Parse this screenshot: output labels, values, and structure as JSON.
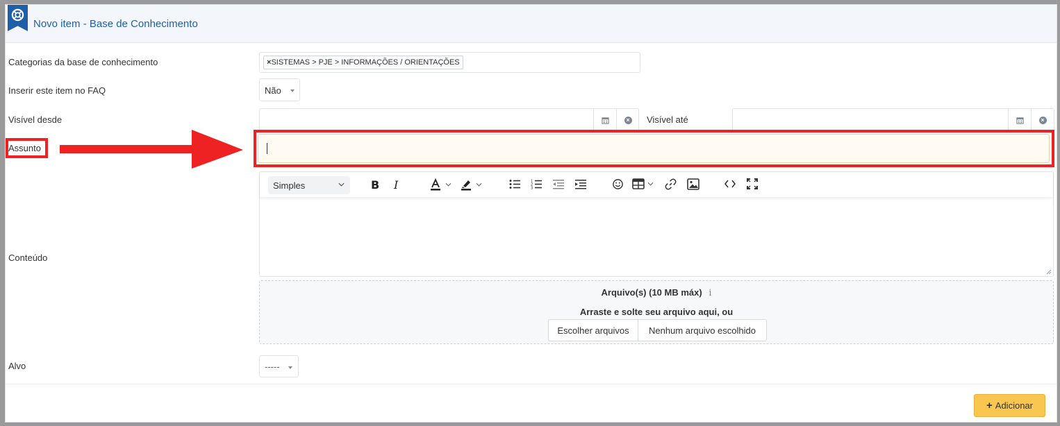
{
  "header": {
    "title": "Novo item - Base de Conhecimento",
    "icon": "lifebuoy-icon",
    "color": "#1f5fa8"
  },
  "form": {
    "categories": {
      "label": "Categorias da base de conhecimento",
      "tag_remove": "×",
      "tag_text": "SISTEMAS > PJE > INFORMAÇÕES / ORIENTAÇÕES"
    },
    "faq": {
      "label": "Inserir este item no FAQ",
      "value": "Não"
    },
    "visible_from": {
      "label": "Visível desde",
      "value": ""
    },
    "visible_until": {
      "label": "Visível até",
      "value": ""
    },
    "subject": {
      "label": "Assunto",
      "value": ""
    },
    "content": {
      "label": "Conteúdo",
      "format_value": "Simples"
    },
    "files": {
      "title": "Arquivo(s) (10 MB máx)",
      "info_icon": "info-icon",
      "drop_text": "Arraste e solte seu arquivo aqui, ou",
      "choose_button": "Escolher arquivos",
      "no_file_text": "Nenhum arquivo escolhido"
    },
    "target": {
      "label": "Alvo",
      "value": "-----"
    }
  },
  "actions": {
    "add_label": "Adicionar",
    "add_icon": "plus-icon",
    "add_color": "#f9c74f"
  },
  "annotations": {
    "highlight_color": "#ee2222"
  }
}
